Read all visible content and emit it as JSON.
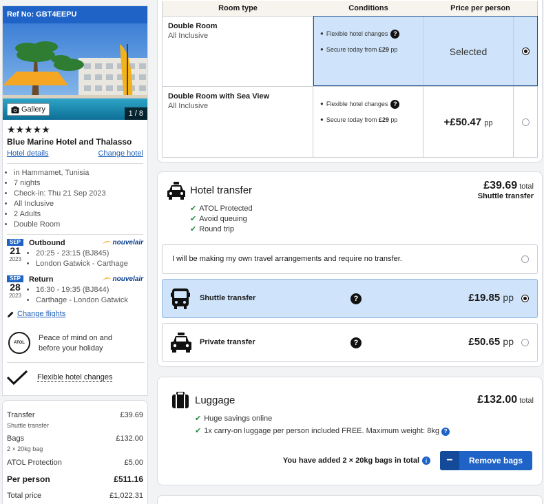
{
  "hotel": {
    "ref": "Ref No: GBT4EEPU",
    "gallery_label": "Gallery",
    "image_counter": "1 / 8",
    "stars": "★★★★★",
    "name": "Blue Marine Hotel and Thalasso",
    "details_link": "Hotel details",
    "change_link": "Change hotel",
    "info": [
      "in Hammamet, Tunisia",
      "7 nights",
      "Check-in: Thu 21 Sep 2023",
      "All Inclusive",
      "2 Adults",
      "Double Room"
    ]
  },
  "flights": [
    {
      "month": "SEP",
      "day": "21",
      "year": "2023",
      "title": "Outbound",
      "airline": "nouvelair",
      "time": "20:25 - 23:15 (BJ845)",
      "route": "London Gatwick - Carthage"
    },
    {
      "month": "SEP",
      "day": "28",
      "year": "2023",
      "title": "Return",
      "airline": "nouvelair",
      "time": "16:30 - 19:35 (BJ844)",
      "route": "Carthage - London Gatwick"
    }
  ],
  "change_flights": "Change flights",
  "atol": {
    "logo_text": "ATOL",
    "line1": "Peace of mind on and",
    "line2": "before your holiday"
  },
  "flexible_changes": "Flexible hotel changes",
  "summary": {
    "transfer_label": "Transfer",
    "transfer_value": "£39.69",
    "transfer_sub": "Shuttle transfer",
    "bags_label": "Bags",
    "bags_value": "£132.00",
    "bags_sub": "2 × 20kg bag",
    "atol_label": "ATOL Protection",
    "atol_value": "£5.00",
    "per_person_label": "Per person",
    "per_person_value": "£511.16",
    "total_label": "Total price",
    "total_value": "£1,022.31"
  },
  "room_table": {
    "headers": [
      "Room type",
      "Conditions",
      "Price per person"
    ],
    "rows": [
      {
        "name": "Double Room",
        "board": "All Inclusive",
        "cond1": "Flexible hotel changes",
        "cond2_prefix": "Secure today from ",
        "cond2_amount": "£29",
        "cond2_suffix": " pp",
        "price": "Selected",
        "selected": true
      },
      {
        "name": "Double Room with Sea View",
        "board": "All Inclusive",
        "cond1": "Flexible hotel changes",
        "cond2_prefix": "Secure today from ",
        "cond2_amount": "£29",
        "cond2_suffix": " pp",
        "price": "+£50.47",
        "price_unit": "pp",
        "selected": false
      }
    ]
  },
  "transfer": {
    "title": "Hotel transfer",
    "total": "£39.69",
    "total_label": "total",
    "selected_name": "Shuttle transfer",
    "features": [
      "ATOL Protected",
      "Avoid queuing",
      "Round trip"
    ],
    "options": [
      {
        "label": "I will be making my own travel arrangements and require no transfer.",
        "selected": false
      },
      {
        "label": "Shuttle transfer",
        "price": "£19.85",
        "unit": "pp",
        "selected": true
      },
      {
        "label": "Private transfer",
        "price": "£50.65",
        "unit": "pp",
        "selected": false
      }
    ]
  },
  "luggage": {
    "title": "Luggage",
    "total": "£132.00",
    "total_label": "total",
    "features": [
      "Huge savings online",
      "1x carry-on luggage per person included FREE. Maximum weight: 8kg"
    ],
    "added_text": "You have added 2 × 20kg bags in total",
    "remove_label": "Remove bags"
  },
  "colors": {
    "accent": "#1f63c6",
    "selected_bg": "#cfe4fa",
    "check": "#1f8a3b"
  }
}
